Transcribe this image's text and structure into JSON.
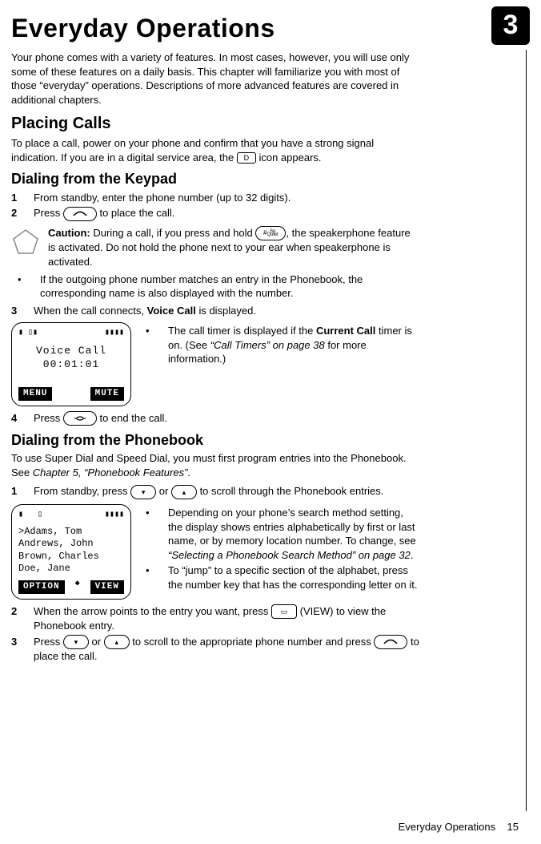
{
  "chapter_number": "3",
  "title": "Everyday Operations",
  "intro": "Your phone comes with a variety of features. In most cases, however, you will use only some of these features on a daily basis. This chapter will familiarize you with most of those “everyday” operations. Descriptions of more advanced features are covered in additional chapters.",
  "section1": {
    "heading": "Placing Calls",
    "intro_a": "To place a call, power on your phone and confirm that you have a strong signal indication. If you are in a digital service area, the ",
    "intro_b": " icon appears."
  },
  "sub1": {
    "heading": "Dialing from the Keypad",
    "step1": {
      "n": "1",
      "t": "From standby, enter the phone number (up to 32 digits)."
    },
    "step2": {
      "n": "2",
      "t_a": "Press ",
      "t_b": " to place the call."
    },
    "caution": {
      "label": "Caution:",
      "a": " During a call, if you press and hold ",
      "b": ", the speakerphone feature is activated. Do not hold the phone next to your ear when speakerphone is activated."
    },
    "bullet1": "If the outgoing phone number matches an entry in the Phonebook, the corresponding name is also displayed with the number.",
    "step3": {
      "n": "3",
      "a": "When the call connects, ",
      "bold": "Voice Call",
      "b": " is displayed."
    },
    "screen": {
      "line1": "Voice Call",
      "line2": "00:01:01",
      "soft_left": "MENU",
      "soft_right": "MUTE"
    },
    "timer_a": "The call timer is displayed if the ",
    "timer_bold": "Current Call",
    "timer_b": " timer is on. (See ",
    "timer_ref": "“Call Timers” on page 38",
    "timer_c": " for more information.)",
    "step4": {
      "n": "4",
      "a": "Press ",
      "b": " to end the call."
    }
  },
  "sub2": {
    "heading": "Dialing from the Phonebook",
    "intro_a": "To use Super Dial and Speed Dial, you must first program entries into the Phonebook. See ",
    "intro_ref": "Chapter 5, “Phonebook Features”",
    "intro_b": ".",
    "step1": {
      "n": "1",
      "a": "From standby, press ",
      "b": " or ",
      "c": " to scroll through the Phonebook entries."
    },
    "screen": {
      "n0": ">Adams, Tom",
      "n1": " Andrews, John",
      "n2": " Brown, Charles",
      "n3": " Doe, Jane",
      "soft_left": "OPTION",
      "soft_right": "VIEW"
    },
    "side_b1_a": "Depending on your phone’s search method setting, the display shows entries alphabetically by first or last name, or by memory location number. To change, see ",
    "side_b1_ref": "“Selecting a Phonebook Search Method” on page 32",
    "side_b1_b": ".",
    "side_b2": "To “jump” to a specific section of the alphabet, press the number key that has the corresponding letter on it.",
    "step2": {
      "n": "2",
      "a": "When the arrow points to the entry you want, press ",
      "b": " (VIEW) to view the Phonebook entry."
    },
    "step3": {
      "n": "3",
      "a": "Press ",
      "b": " or ",
      "c": " to scroll to the appropriate phone number and press ",
      "d": " to place the call."
    }
  },
  "footer": {
    "label": "Everyday Operations",
    "page": "15"
  },
  "keys": {
    "hash": "# Sp Quiet",
    "digital": "D"
  }
}
